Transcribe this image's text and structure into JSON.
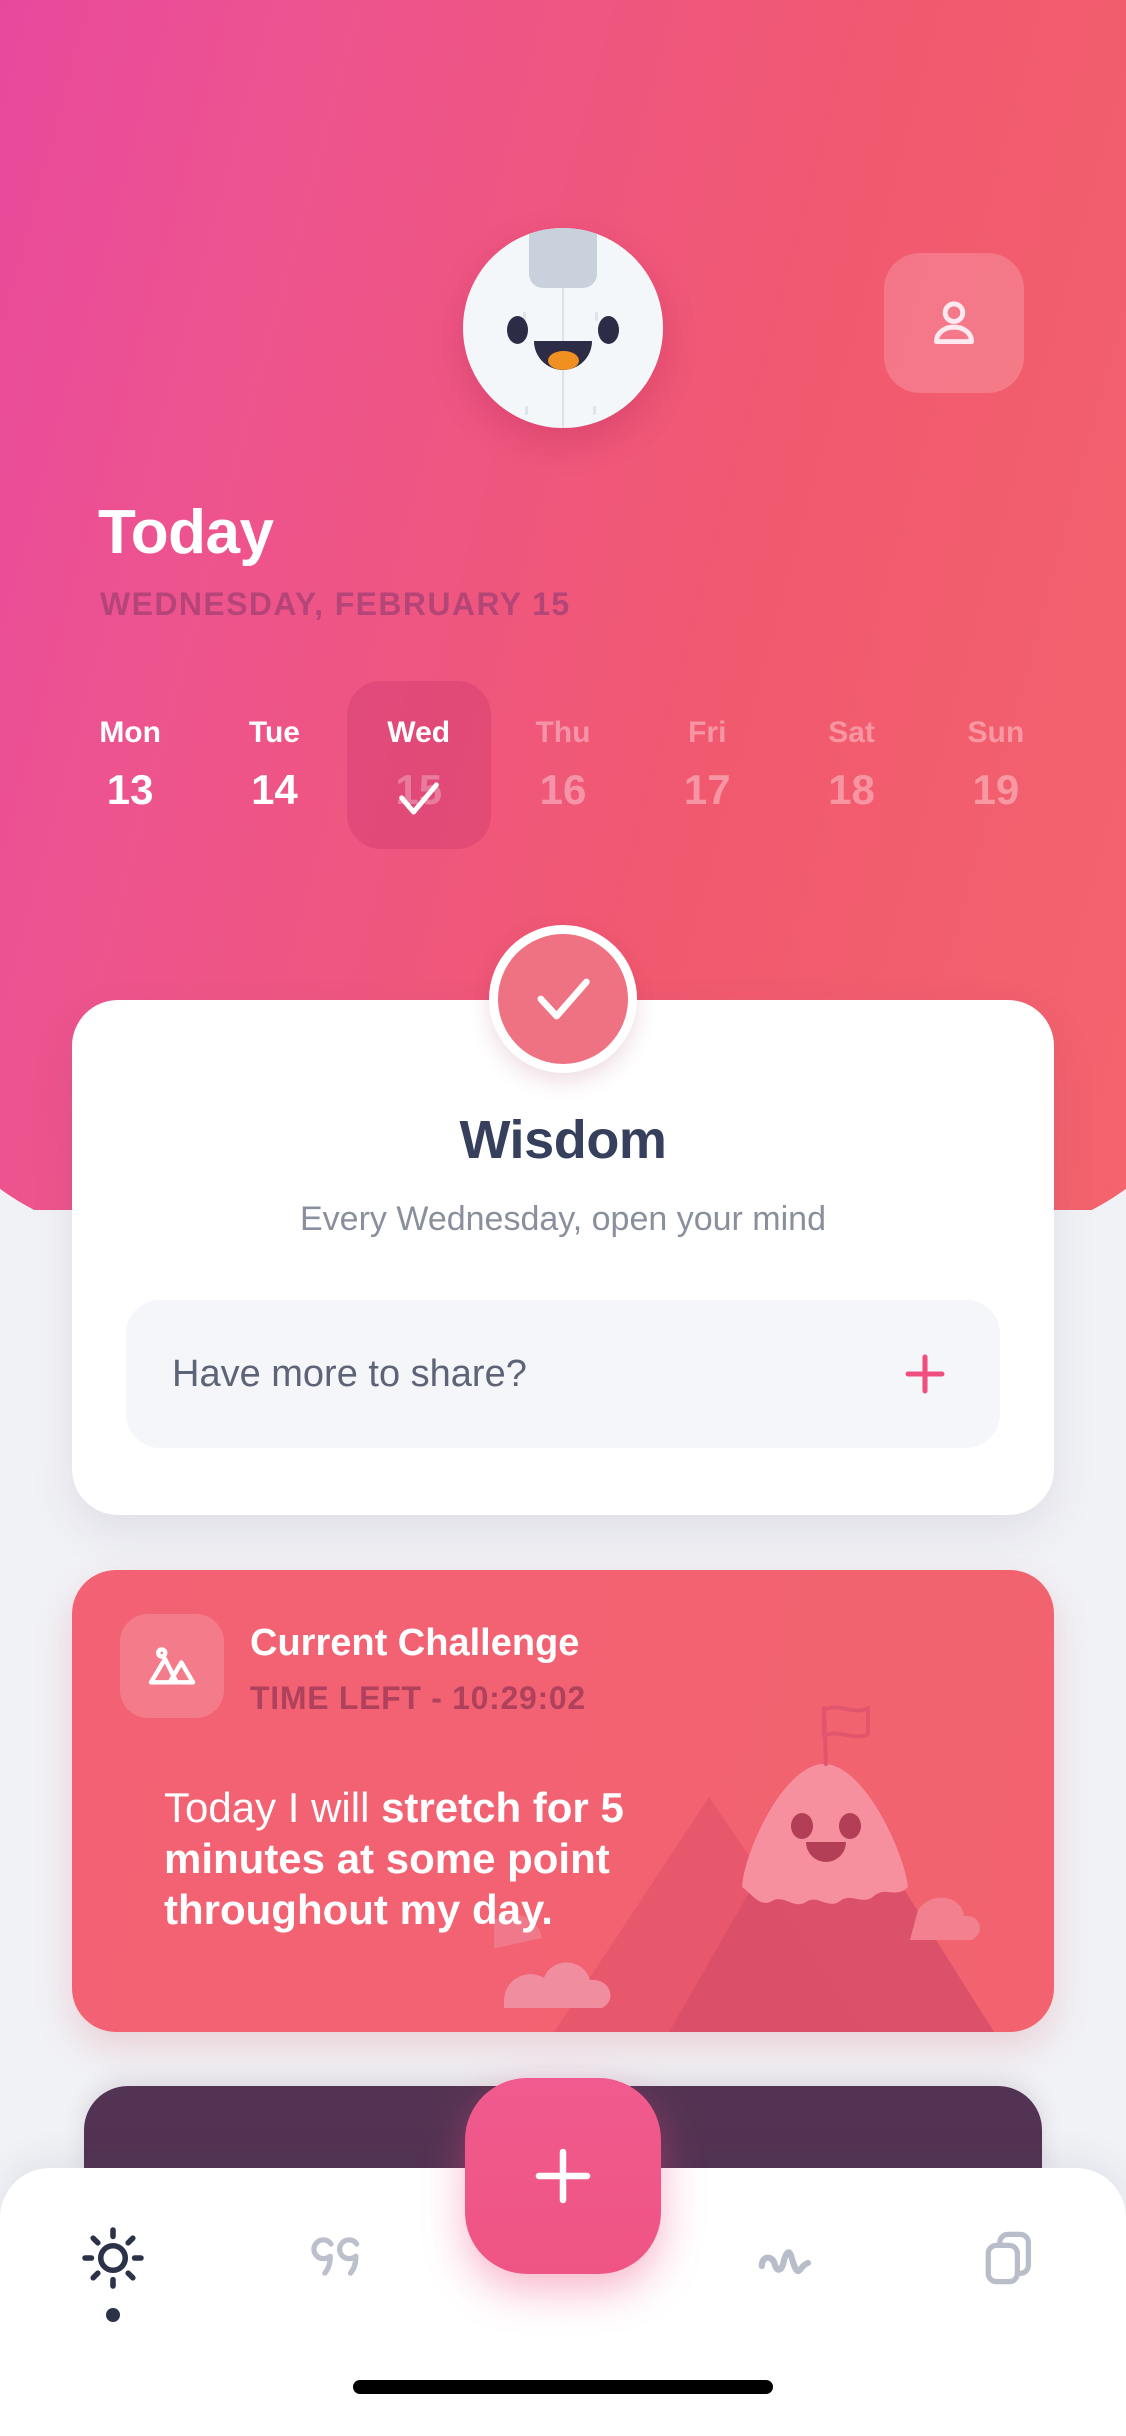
{
  "theme": {
    "gradient_start": "#e8479e",
    "gradient_end": "#f4656d",
    "accent_pink": "#ef5584",
    "card_white": "#ffffff",
    "navy_text": "#36405c",
    "muted_text": "#8a8f9d",
    "peek_card": "#533353",
    "challenge_card": "#f26274",
    "nav_inactive": "#b9bcc9",
    "nav_active": "#2c3348"
  },
  "header": {
    "mascot_icon": "penguin-mascot-avatar",
    "profile_icon": "person-icon",
    "title": "Today",
    "subtitle": "WEDNESDAY, FEBRUARY 15"
  },
  "week": {
    "days": [
      {
        "dow": "Mon",
        "num": "13",
        "state": "past"
      },
      {
        "dow": "Tue",
        "num": "14",
        "state": "past"
      },
      {
        "dow": "Wed",
        "num": "15",
        "state": "active"
      },
      {
        "dow": "Thu",
        "num": "16",
        "state": "future"
      },
      {
        "dow": "Fri",
        "num": "17",
        "state": "future"
      },
      {
        "dow": "Sat",
        "num": "18",
        "state": "future"
      },
      {
        "dow": "Sun",
        "num": "19",
        "state": "future"
      }
    ]
  },
  "wisdom": {
    "badge_icon": "check-circle-icon",
    "title": "Wisdom",
    "subtitle": "Every Wednesday, open your mind",
    "share_placeholder": "Have more to share?",
    "add_icon": "plus-icon"
  },
  "challenge": {
    "icon": "mountain-image-icon",
    "title": "Current Challenge",
    "time_left": "TIME LEFT - 10:29:02",
    "text_prefix": "Today I will ",
    "text_bold": "stretch for 5 minutes at some point throughout my day.",
    "art": "kawaii-mountain-with-flag"
  },
  "bottom_nav": {
    "items": [
      {
        "id": "today",
        "icon": "sun-icon",
        "active": true
      },
      {
        "id": "quotes",
        "icon": "quote-marks-icon",
        "active": false
      },
      {
        "id": "activity",
        "icon": "wave-line-icon",
        "active": false
      },
      {
        "id": "cards",
        "icon": "stacked-cards-icon",
        "active": false
      }
    ],
    "fab_icon": "plus-icon"
  }
}
